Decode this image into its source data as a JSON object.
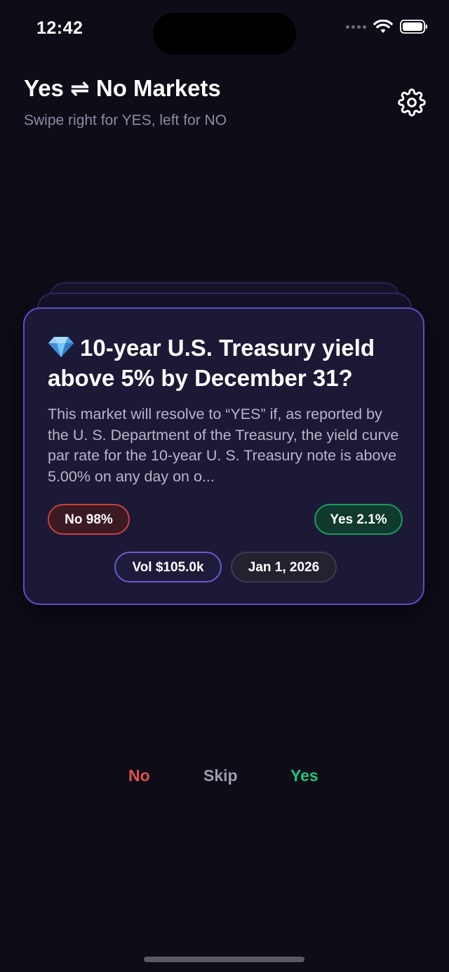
{
  "status_bar": {
    "time": "12:42",
    "icons": [
      "signal-dots-icon",
      "wifi-icon",
      "battery-icon"
    ]
  },
  "header": {
    "title": "Yes ⇌ No Markets",
    "subtitle": "Swipe right for YES, left for NO",
    "settings_icon": "gear-icon"
  },
  "card": {
    "icon": "gem-icon",
    "title": "10-year U.S. Treasury yield above 5% by December 31?",
    "description": "This market will resolve to “YES” if, as reported by the U. S. Department of the Treasury, the yield curve par rate for the 10-year U. S. Treasury note is above 5.00% on any day on o...",
    "no_label": "No 98%",
    "yes_label": "Yes 2.1%",
    "volume": "Vol $105.0k",
    "date": "Jan 1, 2026"
  },
  "actions": {
    "no": "No",
    "skip": "Skip",
    "yes": "Yes"
  },
  "colors": {
    "background": "#0d0c17",
    "card_border": "#5d4fc0",
    "no": "#e2504e",
    "yes": "#22c47c",
    "skip": "#9d9bad"
  }
}
